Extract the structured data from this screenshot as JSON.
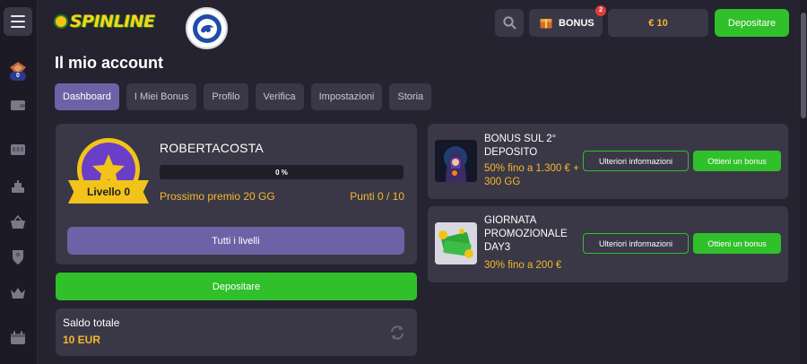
{
  "header": {
    "logo_text": "SPINLINE",
    "bonus_label": "BONUS",
    "bonus_count": "2",
    "balance": "€ 10",
    "deposit_label": "Depositare"
  },
  "sidebar": {
    "badge": "0"
  },
  "page": {
    "title": "Il mio account"
  },
  "tabs": [
    {
      "label": "Dashboard",
      "active": true
    },
    {
      "label": "I Miei Bonus",
      "active": false
    },
    {
      "label": "Profilo",
      "active": false
    },
    {
      "label": "Verifica",
      "active": false
    },
    {
      "label": "Impostazioni",
      "active": false
    },
    {
      "label": "Storia",
      "active": false
    }
  ],
  "profile": {
    "username": "ROBERTACOSTA",
    "level_label": "Livello 0",
    "progress_text": "0 %",
    "progress_value": 0,
    "next_prize": "Prossimo premio 20 GG",
    "points": "Punti 0 / 10",
    "all_levels_label": "Tutti i livelli"
  },
  "deposit_button": "Depositare",
  "balance_card": {
    "label": "Saldo totale",
    "value": "10 EUR"
  },
  "bonuses": [
    {
      "title": "BONUS SUL 2° DEPOSITO",
      "desc": "50% fino a 1.300 € + 300 GG",
      "info_label": "Ulteriori informazioni",
      "get_label": "Ottieni un bonus"
    },
    {
      "title": "GIORNATA PROMOZIONALE DAY3",
      "desc": "30% fino a 200 €",
      "info_label": "Ulteriori informazioni",
      "get_label": "Ottieni un bonus"
    }
  ],
  "colors": {
    "accent_green": "#2fc02a",
    "accent_purple": "#6e62a6",
    "accent_gold": "#f5b82e",
    "card_bg": "#3a3846",
    "page_bg": "#252330"
  }
}
